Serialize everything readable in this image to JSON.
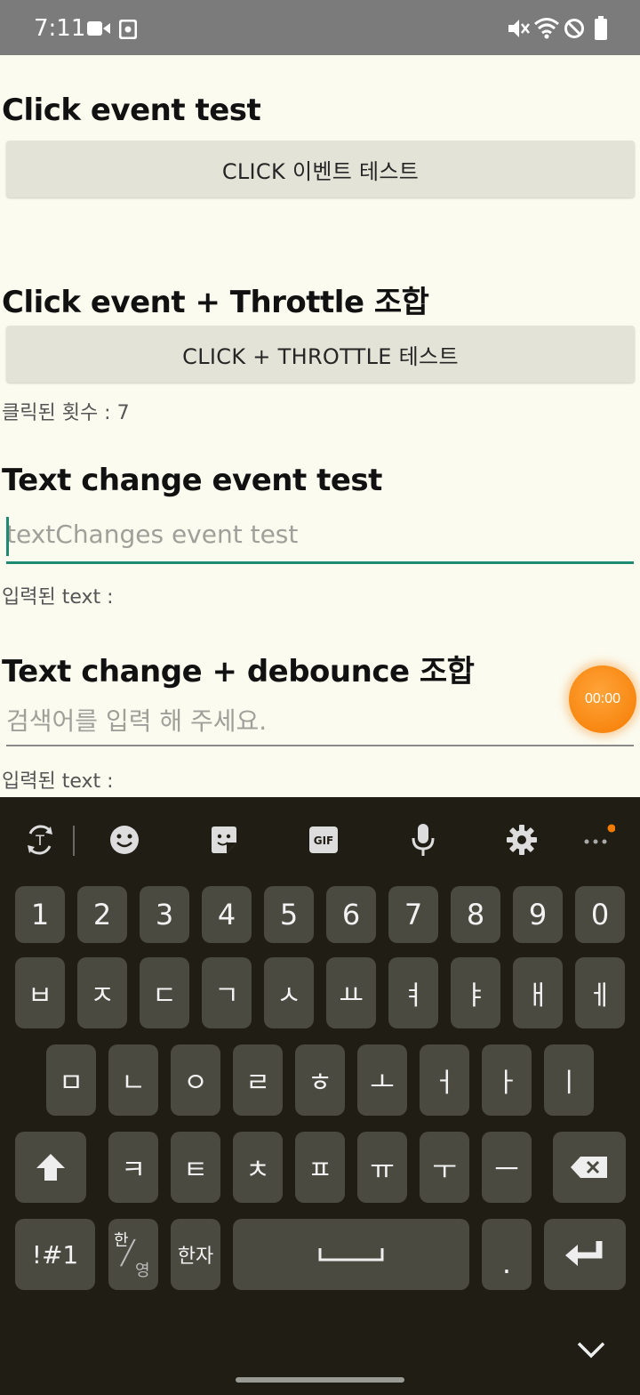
{
  "status_bar": {
    "time": "7:11",
    "icons": [
      "video-camera-icon",
      "screen-record-icon",
      "mute-vibrate-icon",
      "wifi-icon",
      "do-not-disturb-icon",
      "battery-icon"
    ]
  },
  "sections": {
    "click": {
      "heading": "Click event test",
      "button_label": "CLICK 이벤트 테스트"
    },
    "throttle": {
      "heading": "Click event + Throttle 조합",
      "button_label": "CLICK + THROTTLE 테스트",
      "count_text": "클릭된 횟수 : 7"
    },
    "text_change": {
      "heading": "Text change event test",
      "input_placeholder": "textChanges event test",
      "result_text": "입력된 text :"
    },
    "debounce": {
      "heading": "Text change + debounce 조합",
      "input_placeholder": "검색어를 입력 해 주세요.",
      "result_text": "입력된 text :"
    }
  },
  "recorder_badge": "00:00",
  "keyboard": {
    "toolbar": [
      "translate-icon",
      "emoji-icon",
      "sticker-icon",
      "gif-icon",
      "microphone-icon",
      "settings-icon",
      "more-icon"
    ],
    "gif_label": "GIF",
    "number_row": [
      "1",
      "2",
      "3",
      "4",
      "5",
      "6",
      "7",
      "8",
      "9",
      "0"
    ],
    "row1": [
      "ㅂ",
      "ㅈ",
      "ㄷ",
      "ㄱ",
      "ㅅ",
      "ㅛ",
      "ㅕ",
      "ㅑ",
      "ㅐ",
      "ㅔ"
    ],
    "row2": [
      "ㅁ",
      "ㄴ",
      "ㅇ",
      "ㄹ",
      "ㅎ",
      "ㅗ",
      "ㅓ",
      "ㅏ",
      "ㅣ"
    ],
    "row3": [
      "ㅋ",
      "ㅌ",
      "ㅊ",
      "ㅍ",
      "ㅠ",
      "ㅜ",
      "ㅡ"
    ],
    "symbols_label": "!#1",
    "lang_top": "한",
    "lang_bottom": "영",
    "hanja_label": "한자",
    "period_label": ".",
    "accent_color": "#1f8a72",
    "recorder_color": "#f57b00"
  }
}
